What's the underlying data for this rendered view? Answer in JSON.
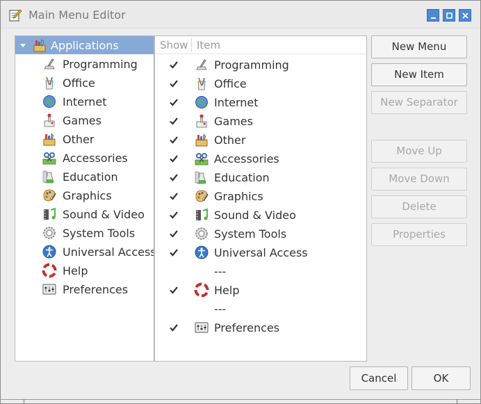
{
  "window": {
    "title": "Main Menu Editor",
    "icon": "menu-editor-icon",
    "controls": [
      "minimize",
      "maximize",
      "close"
    ]
  },
  "tree": {
    "root": {
      "label": "Applications",
      "icon": "applications-icon",
      "expanded": true,
      "selected": true
    },
    "items": [
      {
        "label": "Programming",
        "icon": "programming-icon"
      },
      {
        "label": "Office",
        "icon": "office-icon"
      },
      {
        "label": "Internet",
        "icon": "internet-icon"
      },
      {
        "label": "Games",
        "icon": "games-icon"
      },
      {
        "label": "Other",
        "icon": "other-icon"
      },
      {
        "label": "Accessories",
        "icon": "accessories-icon"
      },
      {
        "label": "Education",
        "icon": "education-icon"
      },
      {
        "label": "Graphics",
        "icon": "graphics-icon"
      },
      {
        "label": "Sound & Video",
        "icon": "sound-video-icon"
      },
      {
        "label": "System Tools",
        "icon": "system-tools-icon"
      },
      {
        "label": "Universal Access",
        "icon": "universal-access-icon"
      },
      {
        "label": "Help",
        "icon": "help-icon"
      },
      {
        "label": "Preferences",
        "icon": "preferences-icon"
      }
    ]
  },
  "list": {
    "headers": {
      "show": "Show",
      "item": "Item"
    },
    "rows": [
      {
        "show": true,
        "label": "Programming",
        "icon": "programming-icon"
      },
      {
        "show": true,
        "label": "Office",
        "icon": "office-icon"
      },
      {
        "show": true,
        "label": "Internet",
        "icon": "internet-icon"
      },
      {
        "show": true,
        "label": "Games",
        "icon": "games-icon"
      },
      {
        "show": true,
        "label": "Other",
        "icon": "other-icon"
      },
      {
        "show": true,
        "label": "Accessories",
        "icon": "accessories-icon"
      },
      {
        "show": true,
        "label": "Education",
        "icon": "education-icon"
      },
      {
        "show": true,
        "label": "Graphics",
        "icon": "graphics-icon"
      },
      {
        "show": true,
        "label": "Sound & Video",
        "icon": "sound-video-icon"
      },
      {
        "show": true,
        "label": "System Tools",
        "icon": "system-tools-icon"
      },
      {
        "show": true,
        "label": "Universal Access",
        "icon": "universal-access-icon"
      },
      {
        "separator": true,
        "label": "---"
      },
      {
        "show": true,
        "label": "Help",
        "icon": "help-icon"
      },
      {
        "separator": true,
        "label": "---"
      },
      {
        "show": true,
        "label": "Preferences",
        "icon": "preferences-icon"
      }
    ]
  },
  "buttons": {
    "new_menu": "New Menu",
    "new_item": "New Item",
    "new_separator": "New Separator",
    "move_up": "Move Up",
    "move_down": "Move Down",
    "delete": "Delete",
    "properties": "Properties",
    "cancel": "Cancel",
    "ok": "OK"
  },
  "colors": {
    "selection": "#87a9d8",
    "window_button": "#4d88d4"
  }
}
